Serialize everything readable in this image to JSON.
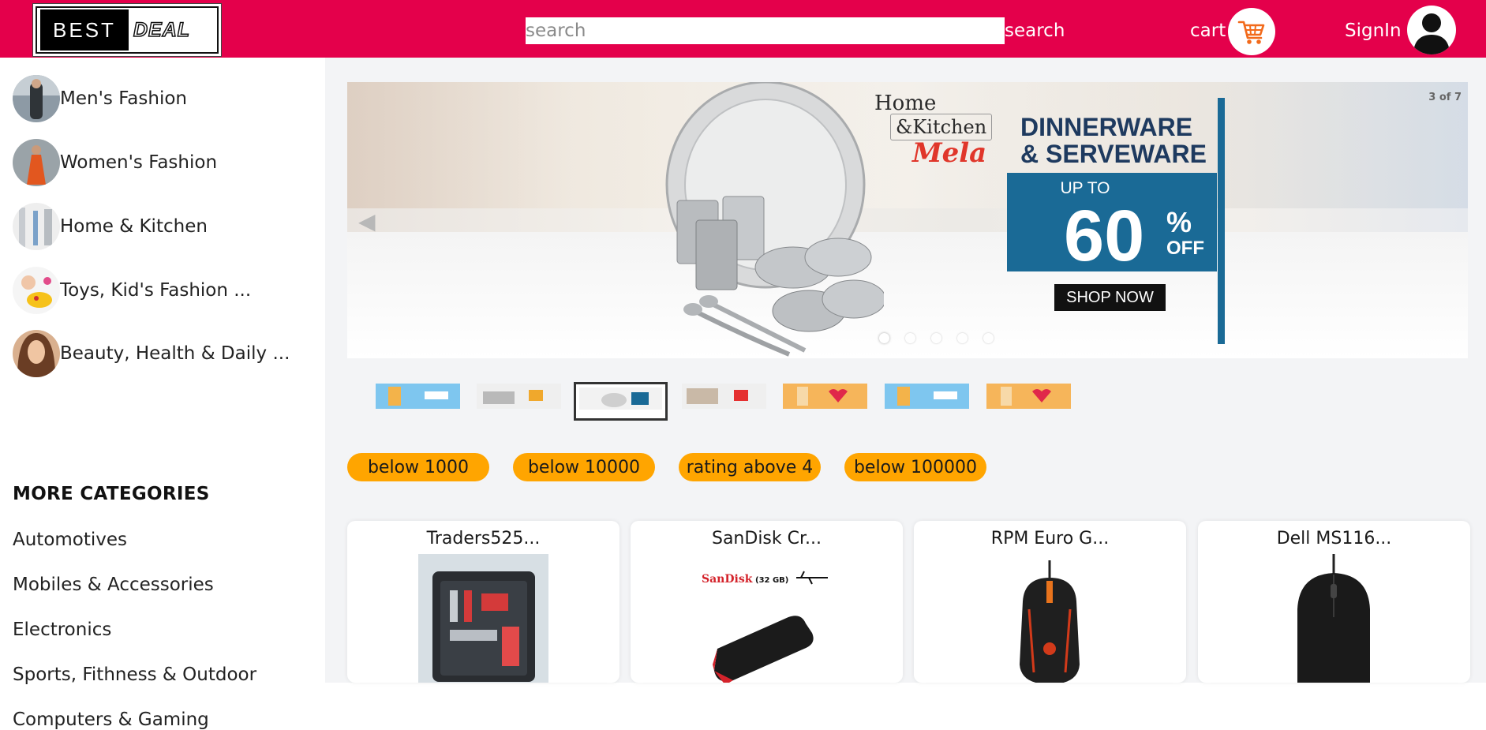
{
  "header": {
    "logo": {
      "word1": "BEST",
      "word2": "DEAL"
    },
    "search": {
      "placeholder": "search",
      "value": "",
      "button_label": "search"
    },
    "cart_label": "cart",
    "signin_label": "SignIn",
    "brand_color": "#e4004b"
  },
  "sidebar": {
    "categories": [
      {
        "label": "Men's Fashion",
        "icon": "mens-fashion-thumb"
      },
      {
        "label": "Women's Fashion",
        "icon": "womens-fashion-thumb"
      },
      {
        "label": "Home & Kitchen",
        "icon": "home-kitchen-thumb"
      },
      {
        "label": "Toys, Kid's Fashion ...",
        "icon": "toys-thumb"
      },
      {
        "label": "Beauty, Health & Daily ...",
        "icon": "beauty-thumb"
      }
    ],
    "more_title": "MORE CATEGORIES",
    "more_items": [
      "Automotives",
      "Mobiles & Accessories",
      "Electronics",
      "Sports, Fithness & Outdoor",
      "Computers & Gaming"
    ]
  },
  "carousel": {
    "counter": "3 of 7",
    "current": 3,
    "total": 7,
    "slide": {
      "brand_line1": "Home",
      "brand_line2": "&Kitchen",
      "brand_line3": "Mela",
      "heading_line1": "DINNERWARE",
      "heading_line2": "& SERVEWARE",
      "upto": "UP TO",
      "percent": "60",
      "percent_sign": "%",
      "off": "OFF",
      "cta": "SHOP NOW"
    },
    "dots_count": 5,
    "active_dot": 1
  },
  "filters": [
    "below 1000",
    "below 10000",
    "rating above 4",
    "below 100000"
  ],
  "products": [
    {
      "title": "Traders525...",
      "image": "tool-kit-image"
    },
    {
      "title": "SanDisk Cr...",
      "image": "usb-drive-image",
      "brand_text": "SanDisk",
      "capacity_text": "(32 GB)"
    },
    {
      "title": "RPM Euro G...",
      "image": "gaming-mouse-image"
    },
    {
      "title": "Dell MS116...",
      "image": "office-mouse-image"
    }
  ],
  "colors": {
    "accent": "#e4004b",
    "filter_pill": "#ffa500",
    "promo_blue": "#1a6a96",
    "promo_heading": "#1e3a5f"
  }
}
